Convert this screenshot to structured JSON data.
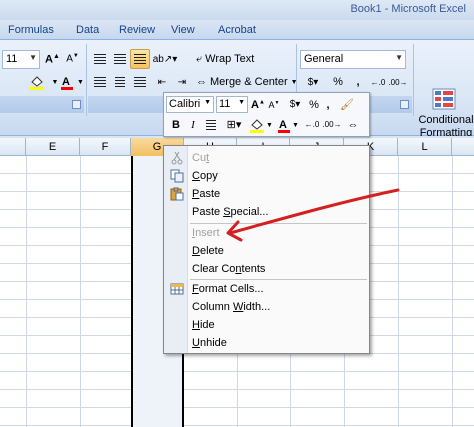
{
  "window": {
    "title": "Book1 - Microsoft Excel"
  },
  "tabs": [
    "Formulas",
    "Data",
    "Review",
    "View",
    "Acrobat"
  ],
  "ribbon": {
    "font_size": "11",
    "wrap_text": "Wrap Text",
    "merge_center": "Merge & Center",
    "number_format": "General",
    "percent_symbol": "%",
    "comma_symbol": ",",
    "conditional_formatting": "Conditional Formatting"
  },
  "columns": [
    "E",
    "F",
    "G",
    "H",
    "I",
    "J",
    "K",
    "L"
  ],
  "mini_toolbar": {
    "font_name": "Calibri",
    "font_size": "11",
    "bold": "B",
    "italic": "I",
    "percent_symbol": "%",
    "comma_symbol": ","
  },
  "context_menu": {
    "items": [
      {
        "key": "cut",
        "pre": "Cu",
        "acc": "t",
        "post": "",
        "enabled": false,
        "icon": "scissors-icon"
      },
      {
        "key": "copy",
        "pre": "",
        "acc": "C",
        "post": "opy",
        "enabled": true,
        "icon": "copy-icon"
      },
      {
        "key": "paste",
        "pre": "",
        "acc": "P",
        "post": "aste",
        "enabled": true,
        "icon": "paste-icon"
      },
      {
        "key": "paste_special",
        "pre": "Paste ",
        "acc": "S",
        "post": "pecial...",
        "enabled": true,
        "icon": ""
      },
      {
        "key": "insert",
        "pre": "",
        "acc": "I",
        "post": "nsert",
        "enabled": false,
        "icon": ""
      },
      {
        "key": "delete",
        "pre": "",
        "acc": "D",
        "post": "elete",
        "enabled": true,
        "icon": ""
      },
      {
        "key": "clear_contents",
        "pre": "Clear Co",
        "acc": "n",
        "post": "tents",
        "enabled": true,
        "icon": ""
      },
      {
        "key": "format_cells",
        "pre": "",
        "acc": "F",
        "post": "ormat Cells...",
        "enabled": true,
        "icon": "format-cells-icon"
      },
      {
        "key": "column_width",
        "pre": "Column ",
        "acc": "W",
        "post": "idth...",
        "enabled": true,
        "icon": ""
      },
      {
        "key": "hide",
        "pre": "",
        "acc": "H",
        "post": "ide",
        "enabled": true,
        "icon": ""
      },
      {
        "key": "unhide",
        "pre": "",
        "acc": "U",
        "post": "nhide",
        "enabled": true,
        "icon": ""
      }
    ]
  },
  "annotation": {
    "color": "#d42020",
    "icon": "red-arrow-annotation"
  },
  "colors": {
    "accent_selected": "#f8c15c",
    "ribbon_bg": "#dbe7f6",
    "font_color_red": "#ff0000",
    "fill_yellow": "#ffff00"
  }
}
